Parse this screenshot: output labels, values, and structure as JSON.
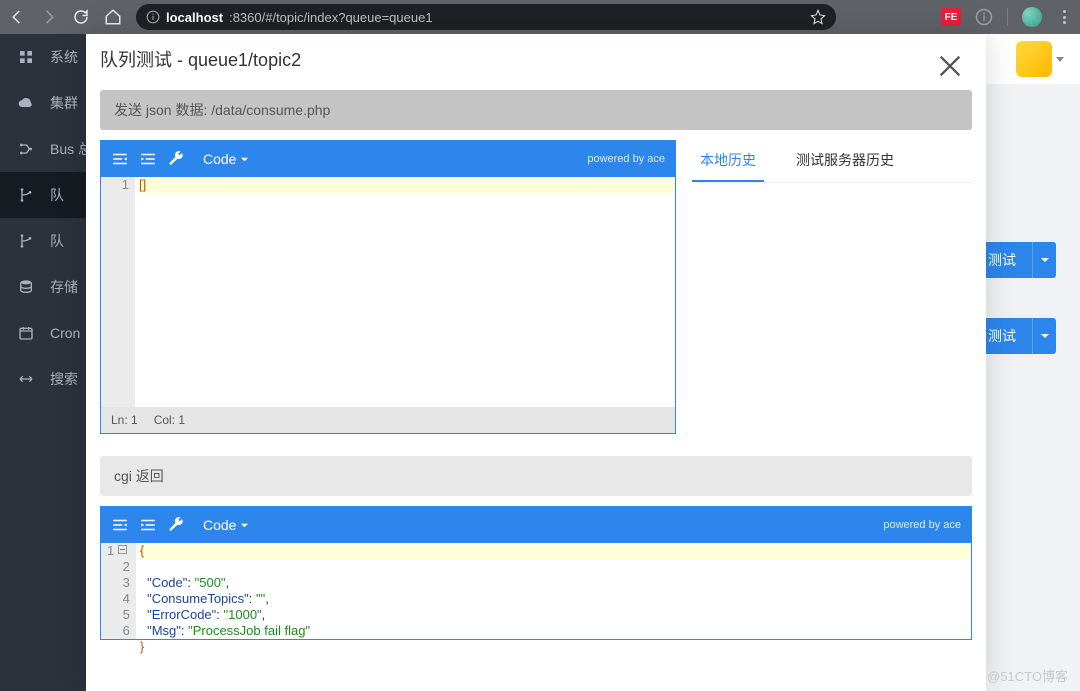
{
  "chrome": {
    "url_host": "localhost",
    "url_rest": ":8360/#/topic/index?queue=queue1",
    "ext_badge": "FE"
  },
  "sidebar": {
    "items": [
      {
        "label": "系统",
        "icon": "grid"
      },
      {
        "label": "集群",
        "icon": "cloud"
      },
      {
        "label": "Bus 总",
        "icon": "bus"
      },
      {
        "label": "队",
        "icon": "branch",
        "active": true
      },
      {
        "label": "队",
        "icon": "branch"
      },
      {
        "label": "存储",
        "icon": "db"
      },
      {
        "label": "Cron",
        "icon": "calendar"
      },
      {
        "label": "搜索",
        "icon": "search"
      }
    ]
  },
  "buttons": {
    "test_label": "测试"
  },
  "modal": {
    "title": "队列测试 - queue1/topic2",
    "send_header": "发送 json 数据: /data/consume.php",
    "cgi_header": "cgi 返回",
    "code_label": "Code",
    "powered": "powered by ace",
    "status_ln": "Ln: 1",
    "status_col": "Col: 1",
    "tabs": {
      "local": "本地历史",
      "server": "测试服务器历史"
    },
    "editor1_line1": "[]",
    "resp": {
      "l1": "{",
      "l2_key": "\"Code\"",
      "l2_val": "\"500\"",
      "l3_key": "\"ConsumeTopics\"",
      "l3_val": "\"\"",
      "l4_key": "\"ErrorCode\"",
      "l4_val": "\"1000\"",
      "l5_key": "\"Msg\"",
      "l5_val": "\"ProcessJob fail flag\"",
      "l6": "}"
    }
  },
  "watermark": "@51CTO博客"
}
